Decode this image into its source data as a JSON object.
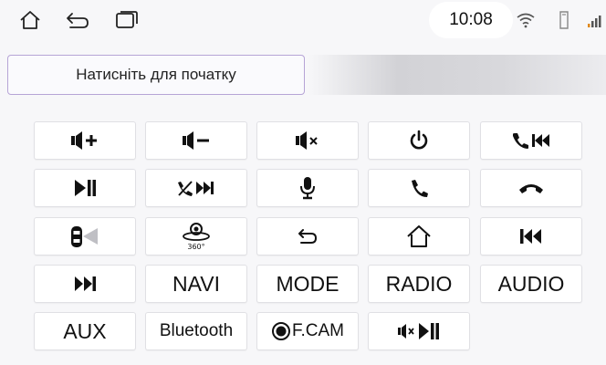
{
  "status": {
    "time": "10:08",
    "icons": [
      "home-icon",
      "back-icon",
      "recent-apps-icon",
      "wifi-icon",
      "sd-card-icon",
      "signal-icon"
    ]
  },
  "prompt": "Натисніть для початку",
  "keys": {
    "row1": [
      "volume-up-icon",
      "volume-down-icon",
      "mute-icon",
      "power-icon",
      "call-previous-icon"
    ],
    "row2": [
      "play-pause-icon",
      "call-end-next-icon",
      "microphone-icon",
      "phone-answer-icon",
      "phone-hangup-icon"
    ],
    "row3": [
      "car-camera-icon",
      "360-view-icon",
      "back-icon",
      "home-icon",
      "previous-track-icon"
    ],
    "row4": {
      "next_icon": "next-track-icon",
      "navi": "NAVI",
      "mode": "MODE",
      "radio": "RADIO",
      "audio": "AUDIO"
    },
    "row5": {
      "aux": "AUX",
      "bluetooth": "Bluetooth",
      "fcam": "F.CAM",
      "mute_play_icon": "mute-play-pause-icon"
    }
  },
  "colors": {
    "prompt_border": "#b6a4d6",
    "signal_accent": "#e0891a",
    "background": "#f7f7f9"
  }
}
